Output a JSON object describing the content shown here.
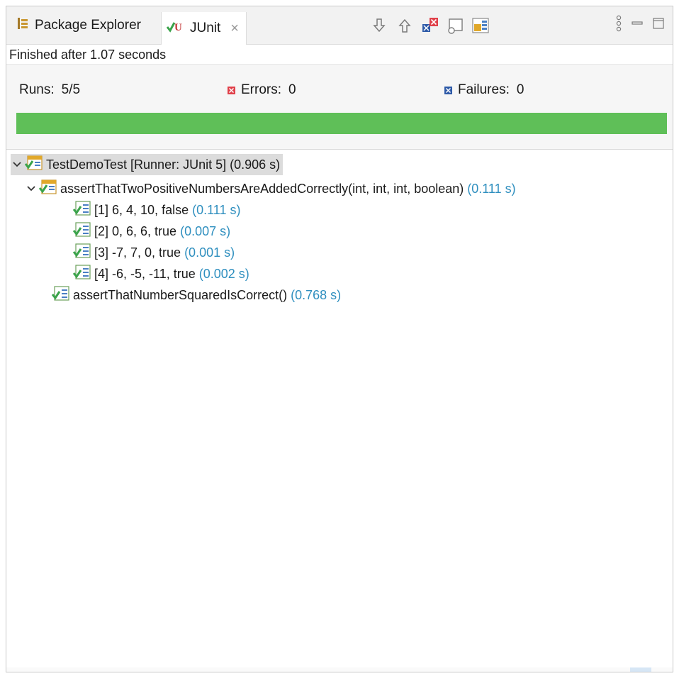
{
  "tabs": {
    "package_explorer_label": "Package Explorer",
    "junit_label": "JUnit",
    "close_glyph": "×"
  },
  "status": {
    "finished_text": "Finished after 1.07 seconds"
  },
  "counters": {
    "runs_label": "Runs:",
    "runs_value": "5/5",
    "errors_label": "Errors:",
    "errors_value": "0",
    "failures_label": "Failures:",
    "failures_value": "0"
  },
  "progress": {
    "fraction": 1.0,
    "color": "#5fbf58"
  },
  "colors": {
    "time": "#2f8fbf",
    "error": "#e0404a",
    "failure": "#2e5aa8"
  },
  "tree": {
    "root": {
      "label": "TestDemoTest [Runner: JUnit 5]",
      "time": "(0.906 s)"
    },
    "children": [
      {
        "label": "assertThatTwoPositiveNumbersAreAddedCorrectly(int, int, int, boolean)",
        "time": "(0.111 s)",
        "children": [
          {
            "label": "[1] 6, 4, 10, false",
            "time": "(0.111 s)"
          },
          {
            "label": "[2] 0, 6, 6, true",
            "time": "(0.007 s)"
          },
          {
            "label": "[3] -7, 7, 0, true",
            "time": "(0.001 s)"
          },
          {
            "label": "[4] -6, -5, -11, true",
            "time": "(0.002 s)"
          }
        ]
      },
      {
        "label": "assertThatNumberSquaredIsCorrect()",
        "time": "(0.768 s)"
      }
    ]
  }
}
